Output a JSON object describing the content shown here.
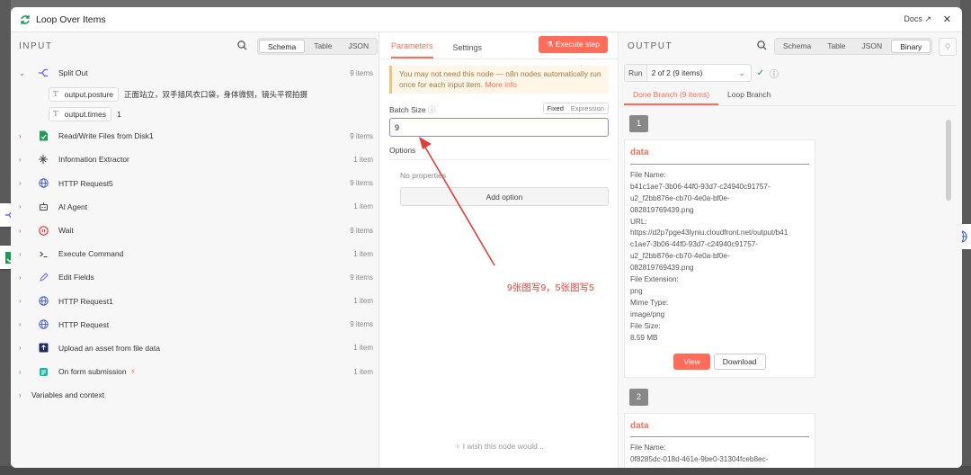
{
  "window": {
    "title": "Loop Over Items",
    "docs_label": "Docs",
    "close": "✕"
  },
  "input": {
    "label": "INPUT",
    "view_tabs": [
      "Schema",
      "Table",
      "JSON"
    ],
    "nodes": [
      {
        "name": "Split Out",
        "count": "9 items",
        "icon": "split-icon",
        "expanded": true,
        "fields": [
          {
            "key": "output.posture",
            "value": "正面站立，双手插风衣口袋，身体微侧，镜头平视拍摄"
          },
          {
            "key": "output.times",
            "value": "1"
          }
        ]
      },
      {
        "name": "Read/Write Files from Disk1",
        "count": "9 items",
        "icon": "file-icon"
      },
      {
        "name": "Information Extractor",
        "count": "1 item",
        "icon": "extract-icon"
      },
      {
        "name": "HTTP Request5",
        "count": "9 items",
        "icon": "globe-icon"
      },
      {
        "name": "AI Agent",
        "count": "1 item",
        "icon": "robot-icon"
      },
      {
        "name": "Wait",
        "count": "9 items",
        "icon": "pause-icon"
      },
      {
        "name": "Execute Command",
        "count": "1 item",
        "icon": "terminal-icon"
      },
      {
        "name": "Edit Fields",
        "count": "9 items",
        "icon": "pen-icon"
      },
      {
        "name": "HTTP Request1",
        "count": "1 item",
        "icon": "globe-icon"
      },
      {
        "name": "HTTP Request",
        "count": "9 items",
        "icon": "globe-icon"
      },
      {
        "name": "Upload an asset from file data",
        "count": "1 item",
        "icon": "upload-icon"
      },
      {
        "name": "On form submission",
        "count": "1 item",
        "icon": "form-icon",
        "trigger": true
      }
    ],
    "variables_label": "Variables and context"
  },
  "params": {
    "tabs": [
      "Parameters",
      "Settings"
    ],
    "execute_label": "Execute step",
    "notice_text": "You may not need this node — n8n nodes automatically run once for each input item.",
    "notice_link": "More info",
    "batch_label": "Batch Size",
    "fixed_label": "Fixed",
    "expression_label": "Expression",
    "batch_value": "9",
    "options_label": "Options",
    "no_properties": "No properties",
    "add_option": "Add option",
    "wish": "I wish this node would..."
  },
  "annotation": "9张图写9，5张图写5",
  "output": {
    "label": "OUTPUT",
    "view_tabs": [
      "Schema",
      "Table",
      "JSON",
      "Binary"
    ],
    "run_label": "Run",
    "run_value": "2 of 2 (9 items)",
    "branches": [
      "Done Branch (9 items)",
      "Loop Branch"
    ],
    "items": [
      {
        "index": "1",
        "title": "data",
        "lines": [
          [
            "File Name:",
            "b41c1ae7-3b06-44f0-93d7-c24940c91757-",
            "u2_f2bb876e-cb70-4e0a-bf0e-",
            "082819769439.png"
          ],
          [
            "URL:",
            "https://d2p7pge43lyniu.cloudfront.net/output/b41",
            "c1ae7-3b06-44f0-93d7-c24940c91757-",
            "u2_f2bb876e-cb70-4e0a-bf0e-",
            "082819769439.png"
          ],
          [
            "File Extension:",
            "png"
          ],
          [
            "Mime Type:",
            "image/png"
          ],
          [
            "File Size:",
            "8.59 MB"
          ]
        ],
        "view": "View",
        "download": "Download"
      },
      {
        "index": "2",
        "title": "data",
        "lines": [
          [
            "File Name:",
            "0f8285dc-018d-461e-9be0-31304fceb8ec-"
          ]
        ]
      }
    ]
  },
  "colors": {
    "accent": "#ff6d5a",
    "annotation": "#e0403a"
  }
}
